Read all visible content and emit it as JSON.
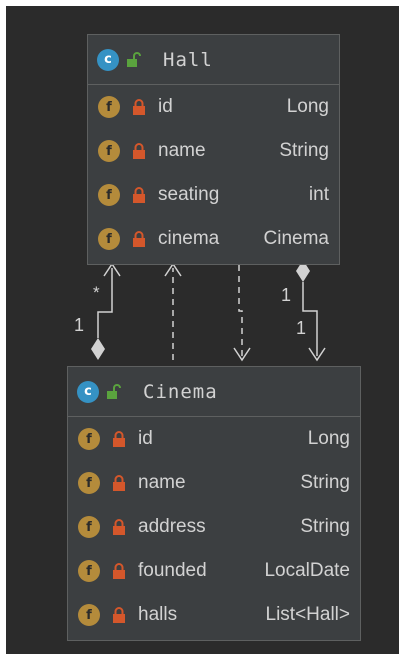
{
  "colors": {
    "background": "#2b2b2b",
    "box": "#3c3f41",
    "class_icon": "#3592c4",
    "field_icon": "#b48b3b",
    "lock": "#d4572b",
    "open_lock": "#5aa33e",
    "text": "#d2d2d2"
  },
  "hall": {
    "icon_letter": "c",
    "name": "Hall",
    "fields": [
      {
        "icon": "f",
        "name": "id",
        "type": "Long"
      },
      {
        "icon": "f",
        "name": "name",
        "type": "String"
      },
      {
        "icon": "f",
        "name": "seating",
        "type": "int"
      },
      {
        "icon": "f",
        "name": "cinema",
        "type": "Cinema"
      }
    ]
  },
  "cinema": {
    "icon_letter": "c",
    "name": "Cinema",
    "fields": [
      {
        "icon": "f",
        "name": "id",
        "type": "Long"
      },
      {
        "icon": "f",
        "name": "name",
        "type": "String"
      },
      {
        "icon": "f",
        "name": "address",
        "type": "String"
      },
      {
        "icon": "f",
        "name": "founded",
        "type": "LocalDate"
      },
      {
        "icon": "f",
        "name": "halls",
        "type": "List<Hall>"
      }
    ]
  },
  "relations": {
    "left_star": "*",
    "left_one": "1",
    "right_one_top": "1",
    "right_one_bottom": "1"
  }
}
